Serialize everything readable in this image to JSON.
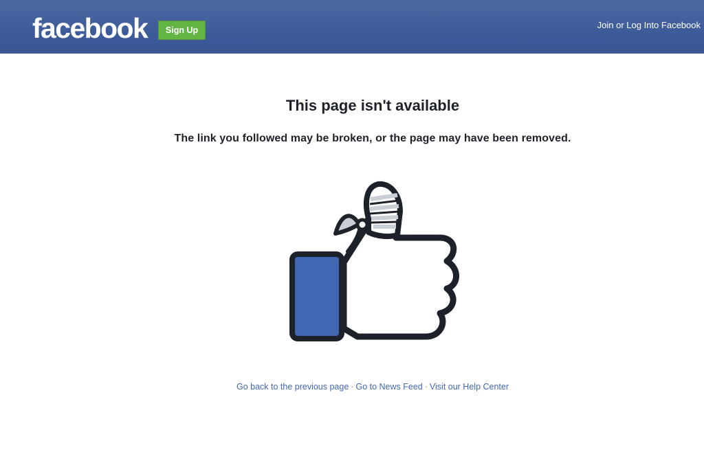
{
  "header": {
    "logo_text": "facebook",
    "signup_label": "Sign Up",
    "join_link": "Join or Log Into Facebook"
  },
  "main": {
    "title": "This page isn't available",
    "message": "The link you followed may be broken, or the page may have been removed.",
    "illustration": "broken-thumbs-up-icon"
  },
  "footer_links": {
    "back": "Go back to the previous page",
    "feed": "Go to News Feed",
    "help": "Visit our Help Center",
    "separator": "·"
  },
  "colors": {
    "brand_blue": "#3b5998",
    "signup_green": "#62b543",
    "link_blue": "#4267b2",
    "text_dark": "#1d2129"
  }
}
